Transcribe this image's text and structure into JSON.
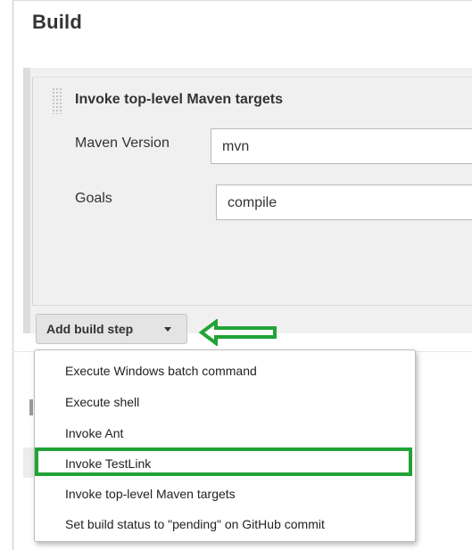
{
  "section": {
    "title": "Build"
  },
  "build_step": {
    "title": "Invoke top-level Maven targets",
    "maven_version": {
      "label": "Maven Version",
      "value": "mvn"
    },
    "goals": {
      "label": "Goals",
      "value": "compile"
    }
  },
  "add_step": {
    "label": "Add build step"
  },
  "menu": {
    "items": [
      "Execute Windows batch command",
      "Execute shell",
      "Invoke Ant",
      "Invoke TestLink",
      "Invoke top-level Maven targets",
      "Set build status to \"pending\" on GitHub commit"
    ],
    "highlighted_item": "Invoke TestLink"
  },
  "colors": {
    "annotation_green": "#21a336",
    "panel_background": "#f0f0f0",
    "button_background": "#e4e4e4"
  },
  "icons": {
    "drag_handle": "grip-dots-icon",
    "dropdown": "caret-down-icon",
    "annotation": "left-arrow-icon"
  }
}
